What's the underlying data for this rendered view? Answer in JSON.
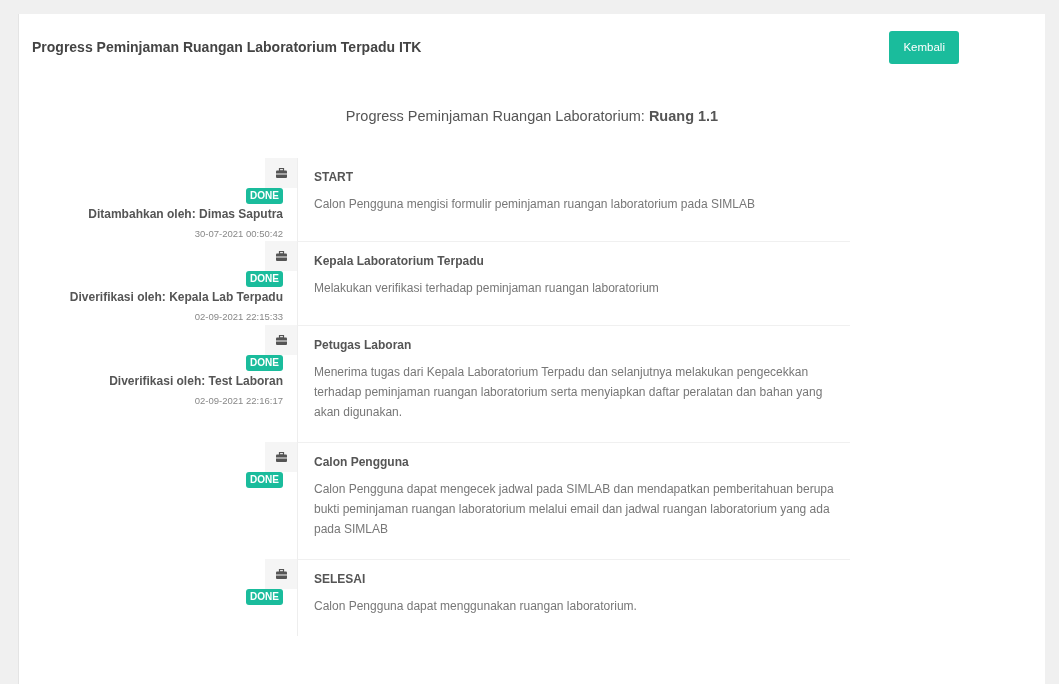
{
  "header": {
    "title": "Progress Peminjaman Ruangan Laboratorium Terpadu ITK",
    "button": "Kembali"
  },
  "subtitle": "Progress Peminjaman Ruangan Laboratorium: **Ruang 1.1**",
  "steps": [
    {
      "badge": "DONE",
      "by": "Ditambahkan oleh: Dimas Saputra",
      "time": "30-07-2021 00:50:42",
      "title": "START",
      "description": "Calon Pengguna mengisi formulir peminjaman ruangan laboratorium pada SIMLAB"
    },
    {
      "badge": "DONE",
      "by": "Diverifikasi oleh: Kepala Lab Terpadu",
      "time": "02-09-2021 22:15:33",
      "title": "Kepala Laboratorium Terpadu",
      "description": "Melakukan verifikasi terhadap peminjaman ruangan laboratorium"
    },
    {
      "badge": "DONE",
      "by": "Diverifikasi oleh: Test Laboran",
      "time": "02-09-2021 22:16:17",
      "title": "Petugas Laboran",
      "description": "Menerima tugas dari Kepala Laboratorium Terpadu dan selanjutnya melakukan pengecekkan terhadap peminjaman ruangan laboratorium serta menyiapkan daftar peralatan dan bahan yang akan digunakan."
    },
    {
      "badge": "DONE",
      "title": "Calon Pengguna",
      "description": "Calon Pengguna dapat mengecek jadwal pada SIMLAB dan mendapatkan pemberitahuan berupa bukti peminjaman ruangan laboratorium melalui email dan jadwal ruangan laboratorium yang ada pada SIMLAB"
    },
    {
      "badge": "DONE",
      "title": "SELESAI",
      "description": "Calon Pengguna dapat menggunakan ruangan laboratorium."
    }
  ]
}
